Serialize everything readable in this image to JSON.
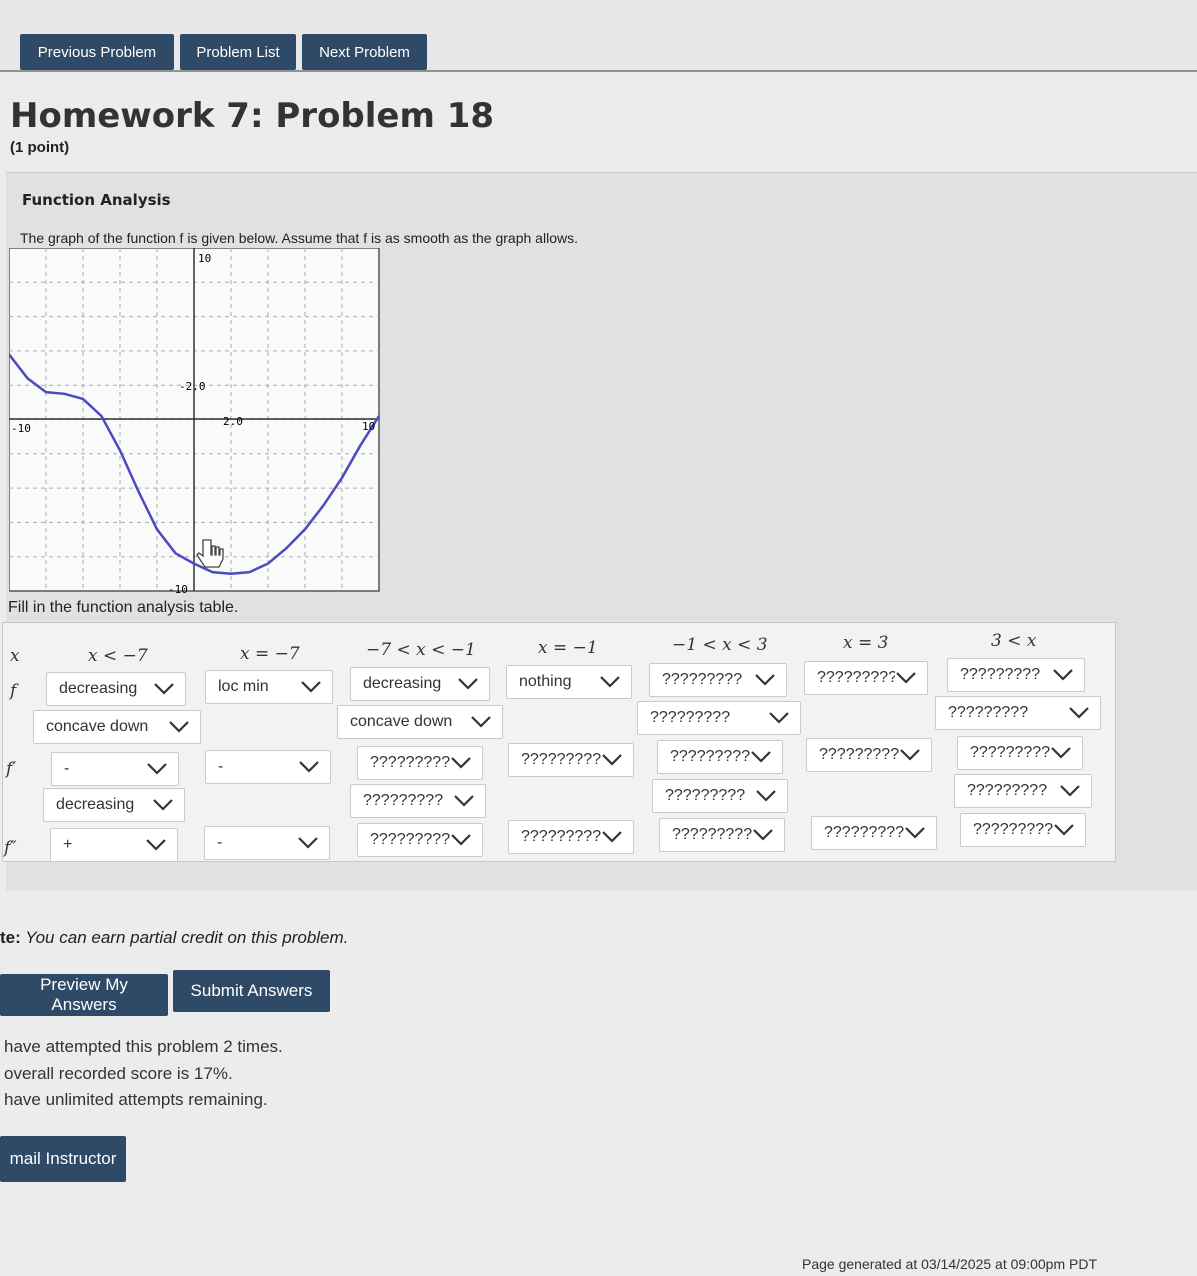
{
  "nav": {
    "previous": "Previous Problem",
    "list": "Problem List",
    "next": "Next Problem"
  },
  "problem": {
    "title": "Homework 7: Problem 18",
    "points": "(1 point)",
    "heading": "Function Analysis",
    "intro": "The graph of the function f is given below. Assume that f is as smooth as the graph allows.",
    "fill_prompt": "Fill in the function analysis table."
  },
  "graph": {
    "labels": {
      "y_top": "10",
      "y_bottom": "-10",
      "x_left": "-10",
      "x_right": "10",
      "tick_neg": "-2.0",
      "tick_pos": "2.0"
    },
    "curve_color": "#4b4bbf",
    "points": [
      [
        -10,
        3.8
      ],
      [
        -9,
        2.4
      ],
      [
        -8,
        1.6
      ],
      [
        -7,
        1.5
      ],
      [
        -6,
        1.2
      ],
      [
        -5,
        0.2
      ],
      [
        -4,
        -1.8
      ],
      [
        -3,
        -4.2
      ],
      [
        -2,
        -6.4
      ],
      [
        -1,
        -7.8
      ],
      [
        0,
        -8.4
      ],
      [
        1,
        -8.9
      ],
      [
        2,
        -9.0
      ],
      [
        3,
        -8.9
      ],
      [
        4,
        -8.4
      ],
      [
        5,
        -7.5
      ],
      [
        6,
        -6.4
      ],
      [
        7,
        -5.0
      ],
      [
        8,
        -3.4
      ],
      [
        9,
        -1.5
      ],
      [
        10,
        0.2
      ]
    ]
  },
  "table": {
    "row_labels": [
      "f",
      "f′",
      "f″"
    ],
    "col_x": "x",
    "headers": [
      "x < −7",
      "x = −7",
      "−7 < x < −1",
      "x = −1",
      "−1 < x < 3",
      "x = 3",
      "3 < x"
    ],
    "f_row1": [
      "decreasing",
      "loc min",
      "decreasing",
      "nothing",
      "?????????",
      "?????????",
      "?????????"
    ],
    "f_row2": [
      "concave down",
      "concave down",
      "?????????",
      "?????????"
    ],
    "fp_row1": [
      "-",
      "-",
      "?????????",
      "?????????",
      "?????????",
      "?????????",
      "?????????"
    ],
    "fp_row2": [
      "decreasing",
      "?????????",
      "?????????",
      "?????????"
    ],
    "fpp_row1": [
      "+",
      "-",
      "?????????",
      "?????????",
      "?????????",
      "?????????",
      "?????????"
    ]
  },
  "note": {
    "prefix": "te:",
    "text": "You can earn partial credit on this problem."
  },
  "buttons": {
    "preview": "Preview My Answers",
    "submit": "Submit Answers",
    "email": "mail Instructor"
  },
  "status": {
    "attempts": "have attempted this problem 2 times.",
    "score": "overall recorded score is 17%.",
    "remaining": "have unlimited attempts remaining."
  },
  "footer": "Page generated at 03/14/2025 at 09:00pm PDT"
}
